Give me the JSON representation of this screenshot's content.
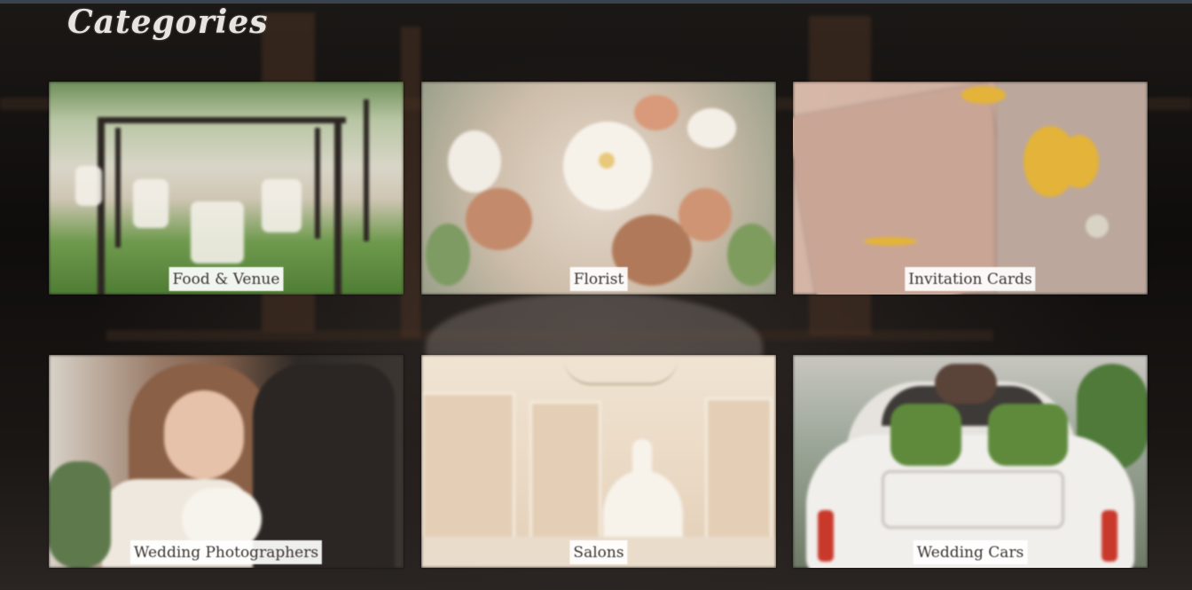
{
  "page": {
    "title": "Categories"
  },
  "categories": [
    {
      "label": "Food & Venue",
      "image": "garden-venue-image"
    },
    {
      "label": "Florist",
      "image": "flower-bouquet-image"
    },
    {
      "label": "Invitation Cards",
      "image": "invitation-card-image"
    },
    {
      "label": "Wedding Photographers",
      "image": "couple-photo-image"
    },
    {
      "label": "Salons",
      "image": "bridal-salon-image"
    },
    {
      "label": "Wedding Cars",
      "image": "wedding-car-image"
    }
  ],
  "colors": {
    "background": "#141110",
    "title": "#e8e4e0",
    "label_bg": "#ffffff",
    "label_text": "#3a3330"
  }
}
